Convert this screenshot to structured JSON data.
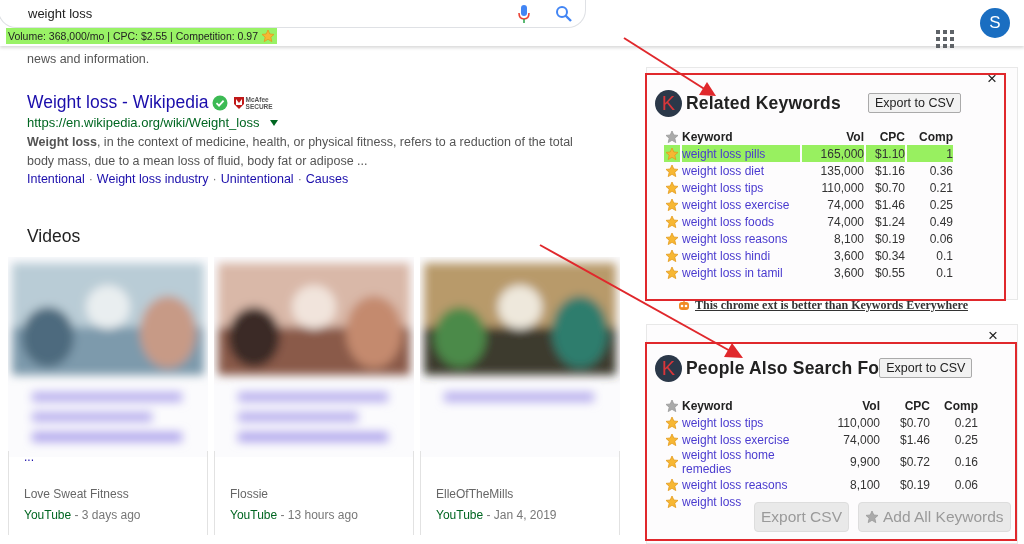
{
  "search": {
    "value": "weight loss",
    "stats": "Volume: 368,000/mo | CPC: $2.55 | Competition: 0.97",
    "avatar": "S"
  },
  "results": {
    "snippet_tail": "news and information.",
    "result": {
      "title": "Weight loss - Wikipedia",
      "verified": true,
      "badge": [
        "McAfee",
        "SECURE"
      ],
      "url": "https://en.wikipedia.org/wiki/Weight_loss",
      "snippet": "**Weight loss**, in the context of medicine, health, or physical fitness, refers to a reduction of the total body mass, due to a mean loss of fluid, body fat or adipose ...",
      "links": [
        "Intentional",
        "Weight loss industry",
        "Unintentional",
        "Causes"
      ],
      "separator": "·"
    }
  },
  "videos": {
    "heading": "Videos",
    "items": [
      {
        "more": "...",
        "channel": "Love Sweat Fitness",
        "source": "YouTube",
        "age": " - 3 days ago"
      },
      {
        "channel": "Flossie",
        "source": "YouTube",
        "age": " - 13 hours ago"
      },
      {
        "channel": "ElleOfTheMills",
        "source": "YouTube",
        "age": " - Jan 4, 2019"
      }
    ]
  },
  "panels": [
    {
      "logo": "K",
      "title": "Related Keywords",
      "export": "Export to CSV",
      "close": "×",
      "columns": [
        "Keyword",
        "Vol",
        "CPC",
        "Comp"
      ],
      "rows": [
        {
          "keyword": "weight loss pills",
          "vol": "165,000",
          "cpc": "$1.10",
          "comp": "1",
          "selected": true
        },
        {
          "keyword": "weight loss diet",
          "vol": "135,000",
          "cpc": "$1.16",
          "comp": "0.36",
          "selected": false
        },
        {
          "keyword": "weight loss tips",
          "vol": "110,000",
          "cpc": "$0.70",
          "comp": "0.21",
          "selected": false
        },
        {
          "keyword": "weight loss exercise",
          "vol": "74,000",
          "cpc": "$1.46",
          "comp": "0.25",
          "selected": false
        },
        {
          "keyword": "weight loss foods",
          "vol": "74,000",
          "cpc": "$1.24",
          "comp": "0.49",
          "selected": false
        },
        {
          "keyword": "weight loss reasons",
          "vol": "8,100",
          "cpc": "$0.19",
          "comp": "0.06",
          "selected": false
        },
        {
          "keyword": "weight loss hindi",
          "vol": "3,600",
          "cpc": "$0.34",
          "comp": "0.1",
          "selected": false
        },
        {
          "keyword": "weight loss in tamil",
          "vol": "3,600",
          "cpc": "$0.55",
          "comp": "0.1",
          "selected": false
        }
      ],
      "footer": "This chrome ext is better than Keywords Everywhere"
    },
    {
      "logo": "K",
      "title": "People Also Search Fo",
      "export": "Export to CSV",
      "close": "×",
      "columns": [
        "Keyword",
        "Vol",
        "CPC",
        "Comp"
      ],
      "rows": [
        {
          "keyword": "weight loss tips",
          "vol": "110,000",
          "cpc": "$0.70",
          "comp": "0.21",
          "selected": false
        },
        {
          "keyword": "weight loss exercise",
          "vol": "74,000",
          "cpc": "$1.46",
          "comp": "0.25",
          "selected": false
        },
        {
          "keyword": "weight loss home remedies",
          "vol": "9,900",
          "cpc": "$0.72",
          "comp": "0.16",
          "selected": false
        },
        {
          "keyword": "weight loss reasons",
          "vol": "8,100",
          "cpc": "$0.19",
          "comp": "0.06",
          "selected": false
        },
        {
          "keyword": "weight loss",
          "selected": false
        }
      ]
    }
  ],
  "floating_buttons": [
    {
      "kind": "plain",
      "label": "Export CSV"
    },
    {
      "kind": "star",
      "label": "Add All Keywords"
    }
  ]
}
